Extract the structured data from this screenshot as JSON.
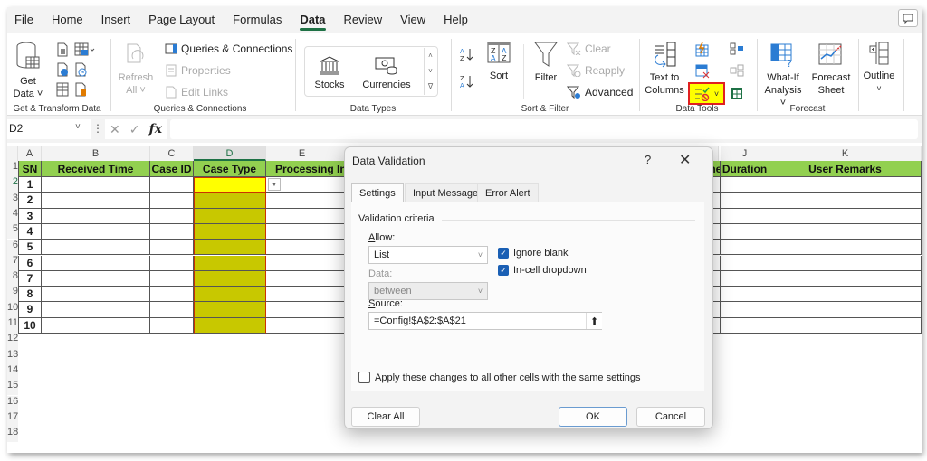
{
  "menubar": {
    "tabs": [
      "File",
      "Home",
      "Insert",
      "Page Layout",
      "Formulas",
      "Data",
      "Review",
      "View",
      "Help"
    ],
    "active": "Data"
  },
  "ribbon": {
    "get_transform": {
      "label": "Get & Transform Data",
      "get_data_line1": "Get",
      "get_data_line2": "Data ˅"
    },
    "queries": {
      "label": "Queries & Connections",
      "refresh_line1": "Refresh",
      "refresh_line2": "All ˅",
      "queries_connections": "Queries & Connections",
      "properties": "Properties",
      "edit_links": "Edit Links"
    },
    "data_types": {
      "label": "Data Types",
      "stocks": "Stocks",
      "currencies": "Currencies"
    },
    "sort_filter": {
      "label": "Sort & Filter",
      "sort": "Sort",
      "filter": "Filter",
      "clear": "Clear",
      "reapply": "Reapply",
      "advanced": "Advanced"
    },
    "data_tools": {
      "label": "Data Tools",
      "text_to_line1": "Text to",
      "text_to_line2": "Columns"
    },
    "forecast": {
      "label": "Forecast",
      "whatif_line1": "What-If",
      "whatif_line2": "Analysis ˅",
      "forecast_line1": "Forecast",
      "forecast_line2": "Sheet"
    },
    "outline": {
      "label": "Outline"
    }
  },
  "formula_bar": {
    "name_box": "D2",
    "formula": ""
  },
  "sheet": {
    "columns": [
      "A",
      "B",
      "C",
      "D",
      "E",
      "J",
      "K"
    ],
    "headers": [
      "SN",
      "Received Time",
      "Case ID",
      "Case Type",
      "Processing In",
      "me",
      "Duration",
      "User Remarks"
    ],
    "rows": [
      "1",
      "2",
      "3",
      "4",
      "5",
      "6",
      "7",
      "8",
      "9",
      "10"
    ],
    "row_numbers": [
      "1",
      "2",
      "3",
      "4",
      "5",
      "6",
      "7",
      "8",
      "9",
      "10",
      "11",
      "12",
      "13",
      "14",
      "15",
      "16",
      "17",
      "18"
    ],
    "colors": {
      "header_fill": "#92d050",
      "selected_cell": "#ffff00",
      "range_fill": "#c8c800"
    }
  },
  "dialog": {
    "title": "Data Validation",
    "help": "?",
    "close": "✕",
    "tabs": [
      "Settings",
      "Input Message",
      "Error Alert"
    ],
    "active_tab": "Settings",
    "section": "Validation criteria",
    "allow_label": "Allow:",
    "allow_value": "List",
    "data_label": "Data:",
    "data_value": "between",
    "ignore_blank": "Ignore blank",
    "ignore_blank_checked": true,
    "incell_dropdown": "In-cell dropdown",
    "incell_dropdown_checked": true,
    "source_label": "Source:",
    "source_value": "=Config!$A$2:$A$21",
    "apply_all": "Apply these changes to all other cells with the same settings",
    "apply_all_checked": false,
    "clear_all": "Clear All",
    "ok": "OK",
    "cancel": "Cancel"
  }
}
